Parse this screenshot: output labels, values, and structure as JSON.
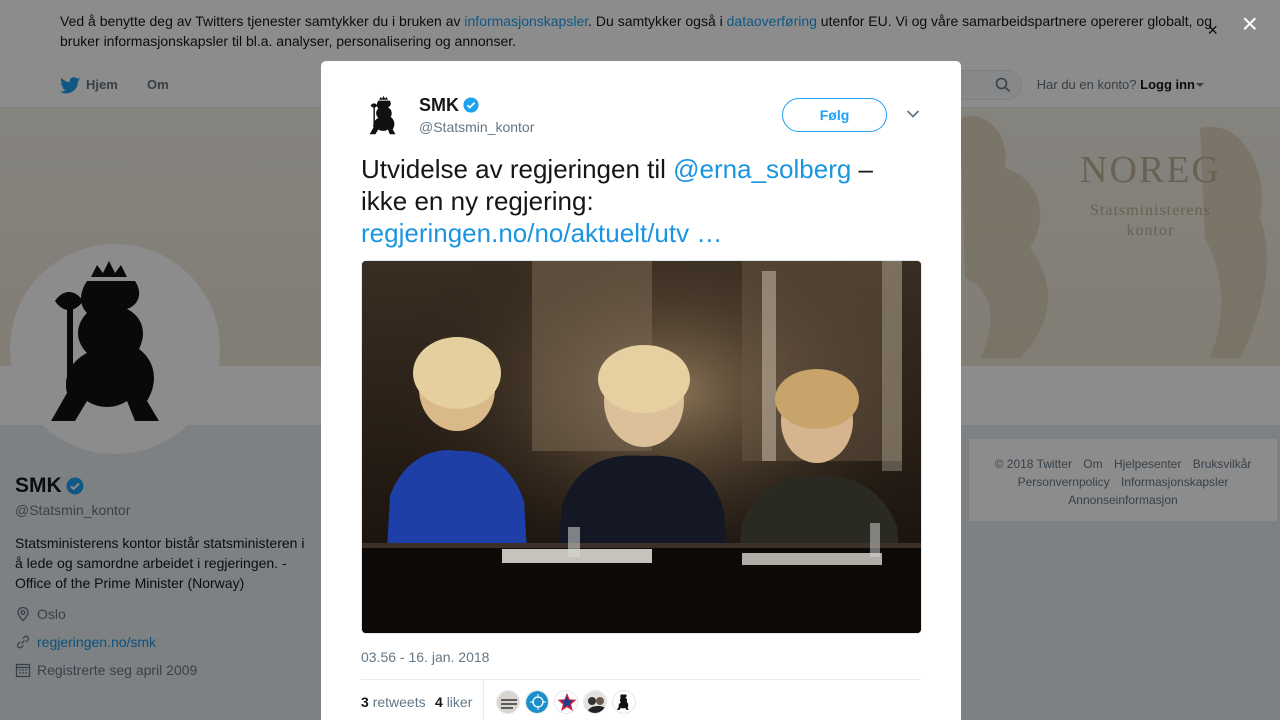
{
  "cookie": {
    "text1": "Ved å benytte deg av Twitters tjenester samtykker du i bruken av ",
    "link1": "informasjonskapsler",
    "text2": ". Du samtykker også i ",
    "link2": "dataoverføring",
    "text3": " utenfor EU. Vi og våre samarbeidspartnere opererer globalt, og bruker informasjonskapsler til bl.a. analyser, personalisering og annonser.",
    "close": "×"
  },
  "nav": {
    "home": "Hjem",
    "about": "Om",
    "login_prompt": "Har du en konto?",
    "login": "Logg inn"
  },
  "banner": {
    "line1": "NOREG",
    "line2": "Statsministerens",
    "line3": "kontor"
  },
  "profile": {
    "name": "SMK",
    "handle": "@Statsmin_kontor",
    "bio": "Statsministerens kontor bistår statsministeren i å lede og samordne arbeidet i regjeringen. - Office of the Prime Minister (Norway)",
    "location": "Oslo",
    "website": "regjeringen.no/smk",
    "joined": "Registrerte seg april 2009"
  },
  "footer": [
    "© 2018 Twitter",
    "Om",
    "Hjelpesenter",
    "Bruksvilkår",
    "Personvernpolicy",
    "Informasjonskapsler",
    "Annonseinformasjon"
  ],
  "overlay": {
    "close": "×"
  },
  "tweet": {
    "name": "SMK",
    "handle": "@Statsmin_kontor",
    "follow": "Følg",
    "text_before": "Utvidelse av regjeringen til ",
    "mention": "@erna_solberg",
    "text_after": " – ikke en ny regjering: ",
    "link": "regjeringen.no/no/aktuelt/utv …",
    "timestamp": "03.56 - 16. jan. 2018",
    "retweets_count": "3",
    "retweets_label": "retweets",
    "likes_count": "4",
    "likes_label": "liker"
  },
  "colors": {
    "accent": "#1da1f2",
    "link": "#1b95e0",
    "text": "#14171a",
    "muted": "#657786"
  },
  "icons": [
    "twitter-bird-icon",
    "search-icon",
    "caret-down-icon",
    "verified-icon",
    "location-icon",
    "link-icon",
    "calendar-icon",
    "chevron-down-icon",
    "close-icon"
  ]
}
